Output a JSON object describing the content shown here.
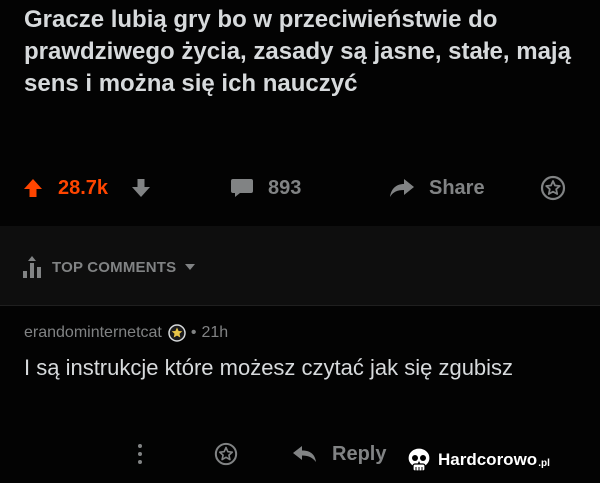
{
  "post": {
    "title": "Gracze lubią gry bo w przeciwieństwie do prawdziwego życia, zasady są jasne, stałe, mają sens i można się ich nauczyć"
  },
  "actions": {
    "score": "28.7k",
    "comment_count": "893",
    "share_label": "Share"
  },
  "comments_header": {
    "sort_label": "TOP COMMENTS"
  },
  "comment": {
    "author": "erandominternetcat",
    "separator": "•",
    "age": "21h",
    "body": "I są instrukcje które możesz czytać jak się zgubisz",
    "reply_label": "Reply"
  },
  "watermark": {
    "text": "Hardcorowo",
    "suffix": ".pl"
  },
  "colors": {
    "upvote": "#ff4500",
    "muted": "#818384",
    "text": "#d7dadc",
    "background": "#030303"
  }
}
